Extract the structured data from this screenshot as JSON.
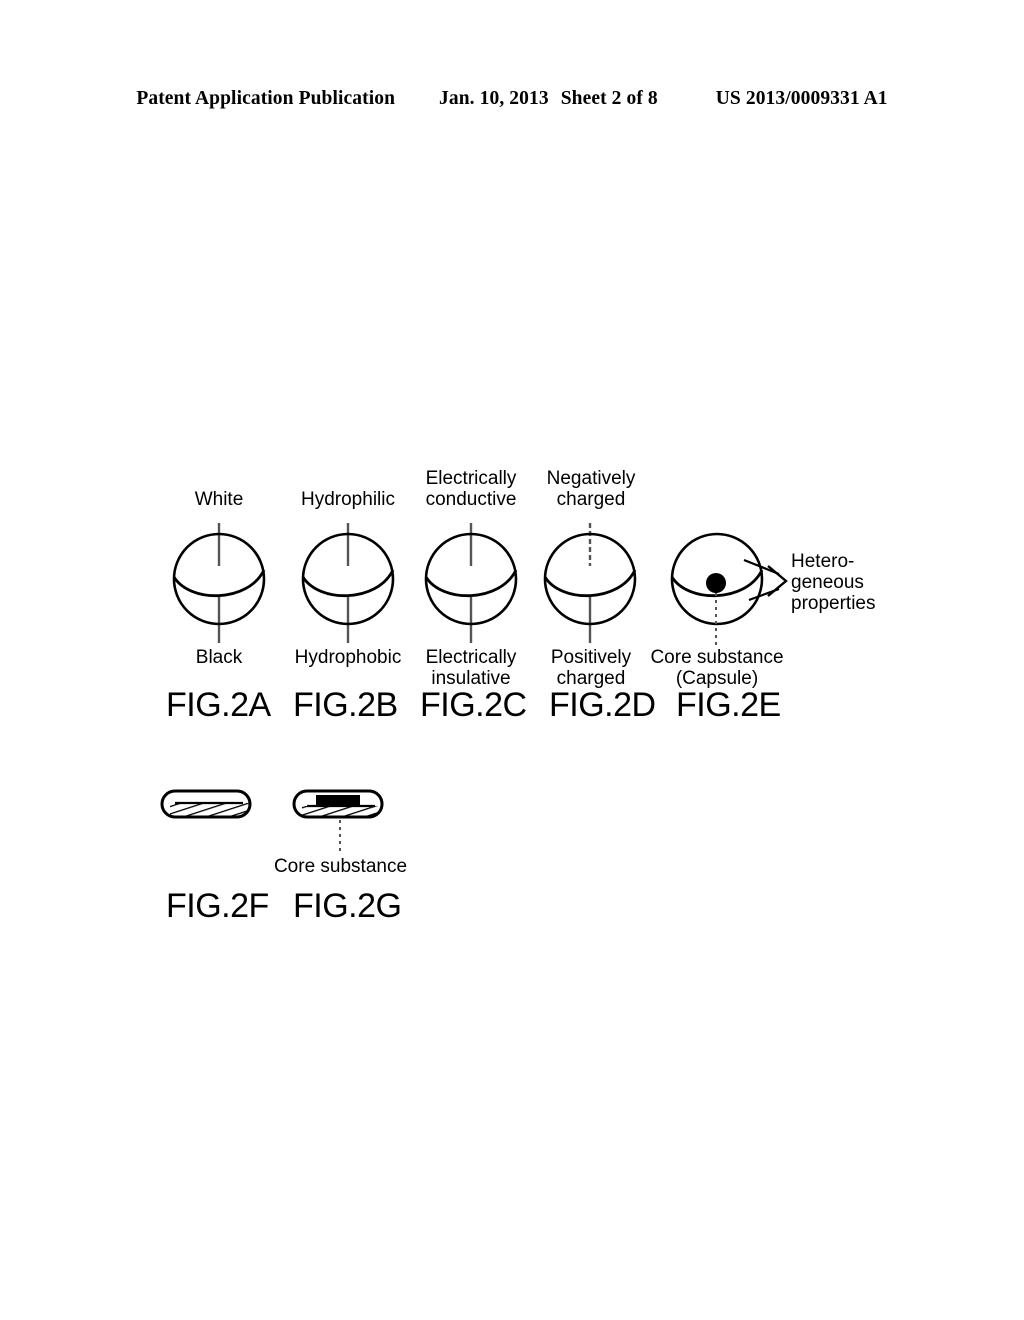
{
  "header": {
    "publication": "Patent Application Publication",
    "date": "Jan. 10, 2013",
    "sheet": "Sheet 2 of 8",
    "number": "US 2013/0009331 A1"
  },
  "figure": {
    "group_id": "FIG.2",
    "spheres": [
      {
        "caption": "FIG.2A",
        "top_label": "White",
        "bottom_label": "Black",
        "has_core": false
      },
      {
        "caption": "FIG.2B",
        "top_label": "Hydrophilic",
        "bottom_label": "Hydrophobic",
        "has_core": false
      },
      {
        "caption": "FIG.2C",
        "top_label": "Electrically\nconductive",
        "bottom_label": "Electrically\ninsulative",
        "has_core": false
      },
      {
        "caption": "FIG.2D",
        "top_label": "Negatively\ncharged",
        "bottom_label": "Positively\ncharged",
        "has_core": false
      },
      {
        "caption": "FIG.2E",
        "top_label": "",
        "bottom_label": "Core substance\n(Capsule)",
        "side_label": "Hetero-\ngeneous\nproperties",
        "has_core": true
      }
    ],
    "rods": [
      {
        "caption": "FIG.2F",
        "label": "",
        "has_core": false
      },
      {
        "caption": "FIG.2G",
        "label": "Core substance",
        "has_core": true
      }
    ]
  },
  "colors": {
    "ink": "#000000",
    "paper": "#ffffff",
    "leader": "#4d4d4d"
  }
}
